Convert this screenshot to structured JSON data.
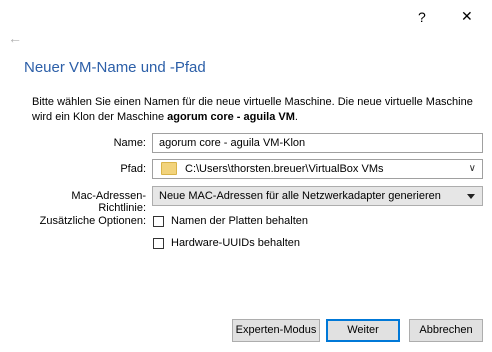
{
  "window": {
    "help_label": "?",
    "close_label": "✕"
  },
  "nav": {
    "back_label": "←"
  },
  "page": {
    "title": "Neuer VM-Name und -Pfad"
  },
  "description": {
    "line1": "Bitte wählen Sie einen Namen für die neue virtuelle Maschine. Die neue virtuelle Maschine",
    "line2_prefix": "wird ein Klon der Maschine ",
    "line2_bold": "agorum core - aguila VM",
    "line2_suffix": "."
  },
  "form": {
    "name_label": "Name:",
    "name_value": "agorum core - aguila VM-Klon",
    "path_label": "Pfad:",
    "path_value": "C:\\Users\\thorsten.breuer\\VirtualBox VMs",
    "mac_label": "Mac-Adressen-Richtlinie:",
    "mac_value": "Neue MAC-Adressen für alle Netzwerkadapter generieren",
    "options_label": "Zusätzliche Optionen:",
    "option_disk_names": "Namen der Platten behalten",
    "option_hw_uuids": "Hardware-UUIDs behalten"
  },
  "buttons": {
    "expert": "Experten-Modus",
    "next": "Weiter",
    "cancel": "Abbrechen"
  },
  "icons": {
    "folder": "folder-icon",
    "chevron": "chevron-down-icon",
    "back": "back-arrow-icon"
  },
  "colors": {
    "title": "#2c5fa8",
    "default_button_border": "#0078d7"
  }
}
